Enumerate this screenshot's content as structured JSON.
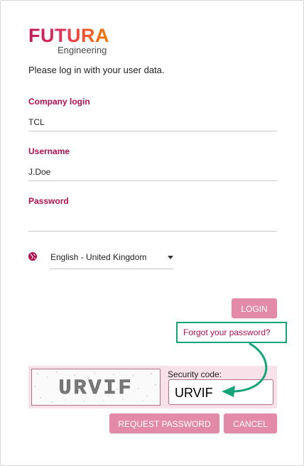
{
  "logo": {
    "name": "FUTURA",
    "subtitle": "Engineering"
  },
  "intro_text": "Please log in with your user data.",
  "fields": {
    "company": {
      "label": "Company login",
      "value": "TCL"
    },
    "username": {
      "label": "Username",
      "value": "J.Doe"
    },
    "password": {
      "label": "Password",
      "value": ""
    }
  },
  "language": {
    "selected": "English - United Kingdom",
    "icon": "globe-icon"
  },
  "login_label": "LOGIN",
  "forgot_label": "Forgot your password?",
  "captcha": {
    "image_text": "URVIF",
    "security_label": "Security code:",
    "security_value": "URVIF"
  },
  "request_label": "REQUEST PASSWORD",
  "cancel_label": "CANCEL",
  "colors": {
    "brand_primary": "#b0104f",
    "button_bg": "#e38aa8",
    "captcha_panel": "#f8e1e9",
    "annotation_green": "#15a37a"
  }
}
